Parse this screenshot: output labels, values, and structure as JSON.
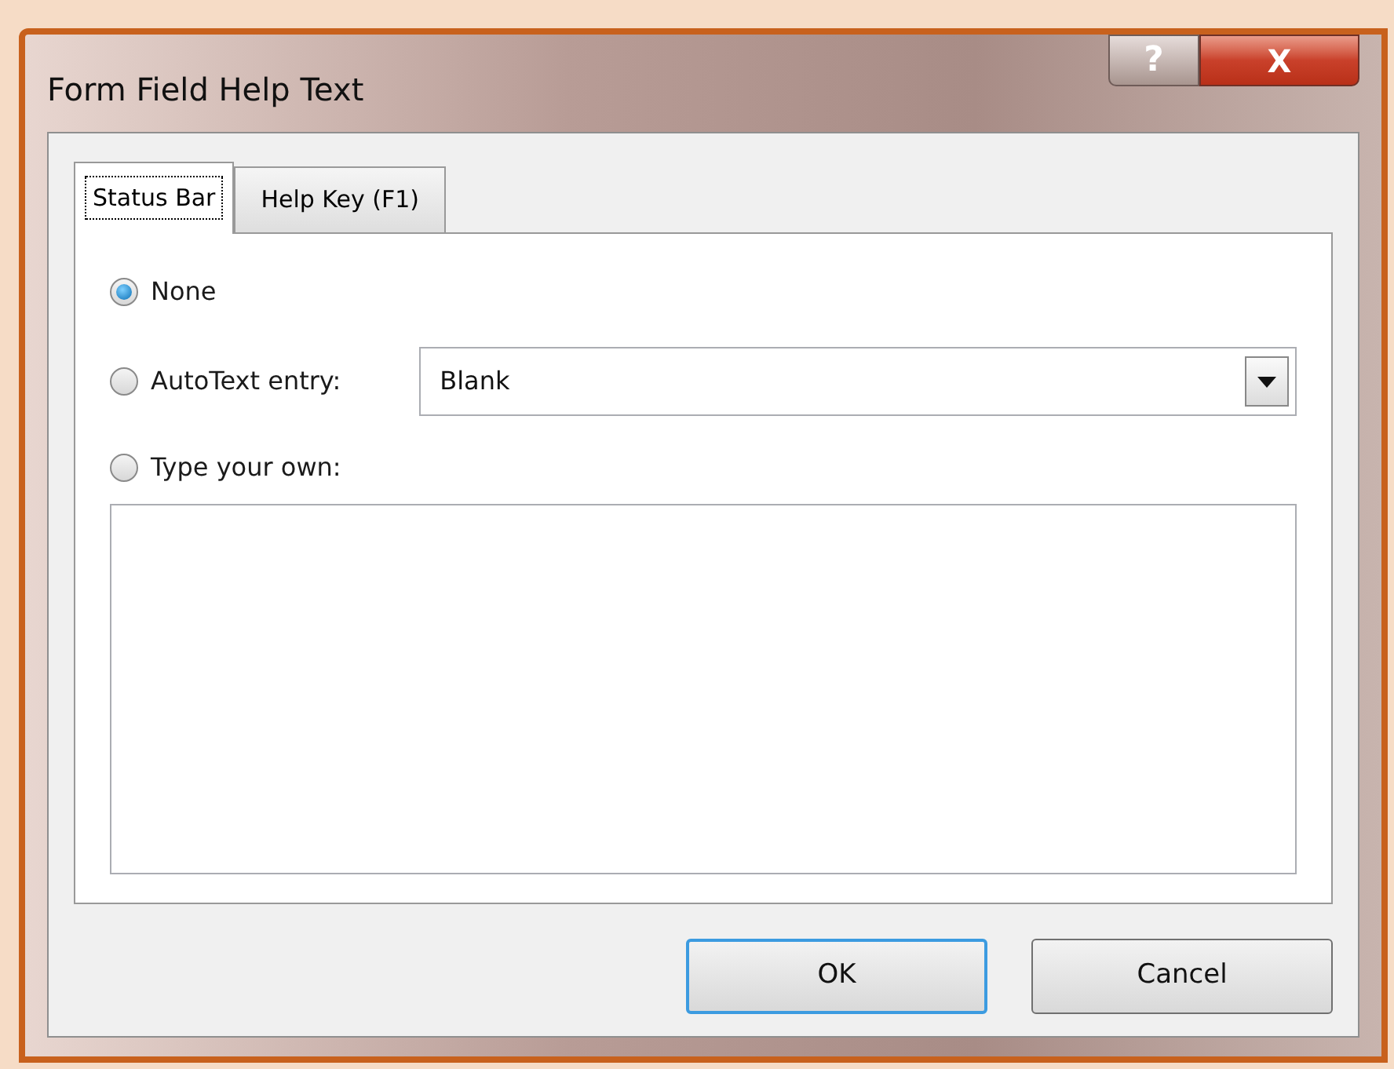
{
  "window": {
    "title": "Form Field Help Text",
    "help_button": "?",
    "close_button": "X"
  },
  "tabs": [
    {
      "label": "Status Bar",
      "selected": true
    },
    {
      "label": "Help Key (F1)",
      "selected": false
    }
  ],
  "options": [
    {
      "label": "None",
      "selected": true
    },
    {
      "label": "AutoText entry:",
      "selected": false
    },
    {
      "label": "Type your own:",
      "selected": false
    }
  ],
  "autotext_dropdown": {
    "value": "Blank"
  },
  "buttons": [
    {
      "label": "OK",
      "default": true
    },
    {
      "label": "Cancel",
      "default": false
    }
  ]
}
